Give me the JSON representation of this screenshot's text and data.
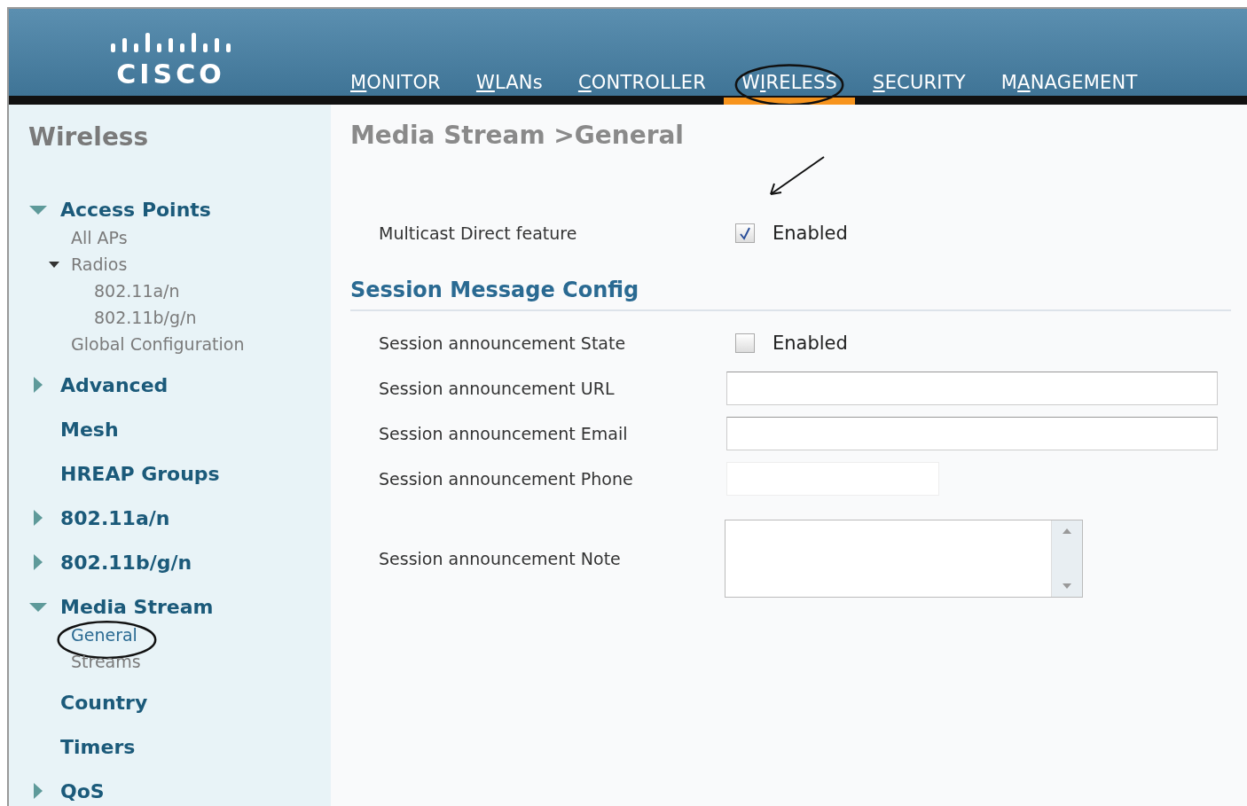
{
  "header": {
    "logo_text": "CISCO",
    "nav": [
      {
        "key": "M",
        "post": "ONITOR",
        "selected": false,
        "circled": false
      },
      {
        "key": "W",
        "post": "LANs",
        "selected": false,
        "circled": false
      },
      {
        "key": "C",
        "post": "ONTROLLER",
        "selected": false,
        "circled": false
      },
      {
        "pre": "W",
        "key": "I",
        "post": "RELESS",
        "selected": true,
        "circled": true
      },
      {
        "key": "S",
        "post": "ECURITY",
        "selected": false,
        "circled": false
      },
      {
        "pre": "M",
        "key": "A",
        "post": "NAGEMENT",
        "selected": false,
        "circled": false
      }
    ]
  },
  "sidebar": {
    "title": "Wireless",
    "items": [
      {
        "label": "Access Points",
        "expanded": true,
        "children": [
          {
            "label": "All APs"
          },
          {
            "label": "Radios",
            "expanded": true,
            "children": [
              {
                "label": "802.11a/n"
              },
              {
                "label": "802.11b/g/n"
              }
            ]
          },
          {
            "label": "Global Configuration"
          }
        ]
      },
      {
        "label": "Advanced",
        "expanded": false
      },
      {
        "label": "Mesh"
      },
      {
        "label": "HREAP Groups"
      },
      {
        "label": "802.11a/n",
        "expanded": false
      },
      {
        "label": "802.11b/g/n",
        "expanded": false
      },
      {
        "label": "Media Stream",
        "expanded": true,
        "children": [
          {
            "label": "General",
            "selected": true
          },
          {
            "label": "Streams",
            "selected": false
          }
        ]
      },
      {
        "label": "Country"
      },
      {
        "label": "Timers"
      },
      {
        "label": "QoS",
        "expanded": false
      }
    ]
  },
  "content": {
    "title": "Media Stream >General",
    "multicast": {
      "label": "Multicast Direct feature",
      "checked": true,
      "option": "Enabled",
      "pointed": true
    },
    "section": {
      "title": "Session Message Config",
      "rows": [
        {
          "kind": "checkbox",
          "label": "Session announcement State",
          "checked": false,
          "option": "Enabled"
        },
        {
          "kind": "wide",
          "label": "Session announcement URL"
        },
        {
          "kind": "wide",
          "label": "Session announcement Email"
        },
        {
          "kind": "short",
          "label": "Session announcement Phone"
        },
        {
          "kind": "textarea",
          "label": "Session announcement Note"
        }
      ]
    }
  }
}
